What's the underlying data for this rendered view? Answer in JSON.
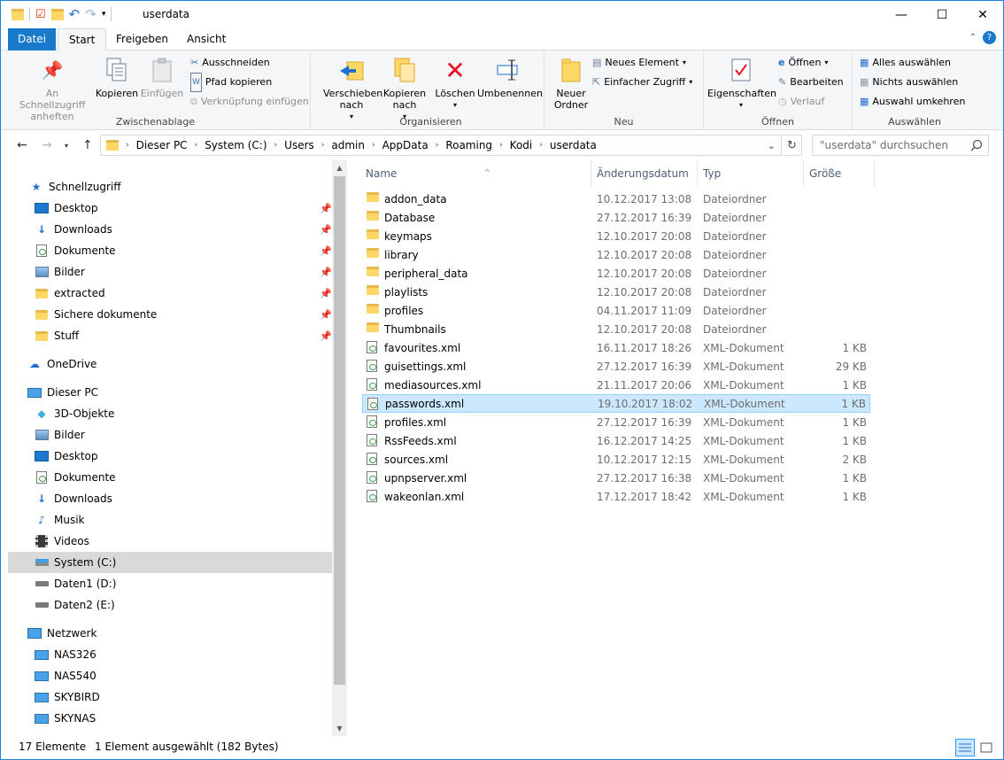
{
  "window": {
    "title": "userdata",
    "minimize": "—",
    "maximize": "☐",
    "close": "✕"
  },
  "tabs": [
    {
      "label": "Datei"
    },
    {
      "label": "Start"
    },
    {
      "label": "Freigeben"
    },
    {
      "label": "Ansicht"
    }
  ],
  "ribbon": {
    "clipboard": {
      "group_label": "Zwischenablage",
      "pin_quick_access": "An Schnellzugriff anheften",
      "copy": "Kopieren",
      "paste": "Einfügen",
      "cut": "Ausschneiden",
      "copy_path": "Pfad kopieren",
      "paste_shortcut": "Verknüpfung einfügen"
    },
    "organize": {
      "group_label": "Organisieren",
      "move_to": "Verschieben nach",
      "copy_to": "Kopieren nach",
      "delete": "Löschen",
      "rename": "Umbenennen"
    },
    "new": {
      "group_label": "Neu",
      "new_folder": "Neuer Ordner",
      "new_item": "Neues Element",
      "easy_access": "Einfacher Zugriff"
    },
    "open": {
      "group_label": "Öffnen",
      "properties": "Eigenschaften",
      "open": "Öffnen",
      "edit": "Bearbeiten",
      "history": "Verlauf"
    },
    "select": {
      "group_label": "Auswählen",
      "select_all": "Alles auswählen",
      "select_none": "Nichts auswählen",
      "invert": "Auswahl umkehren"
    }
  },
  "address": {
    "crumbs": [
      "Dieser PC",
      "System (C:)",
      "Users",
      "admin",
      "AppData",
      "Roaming",
      "Kodi",
      "userdata"
    ],
    "search_placeholder": "\"userdata\" durchsuchen"
  },
  "nav": {
    "quick_access": "Schnellzugriff",
    "quick_items": [
      "Desktop",
      "Downloads",
      "Dokumente",
      "Bilder",
      "extracted",
      "Sichere dokumente",
      "Stuff"
    ],
    "onedrive": "OneDrive",
    "this_pc": "Dieser PC",
    "pc_items": [
      "3D-Objekte",
      "Bilder",
      "Desktop",
      "Dokumente",
      "Downloads",
      "Musik",
      "Videos",
      "System (C:)",
      "Daten1 (D:)",
      "Daten2 (E:)"
    ],
    "network": "Netzwerk",
    "network_items": [
      "NAS326",
      "NAS540",
      "SKYBIRD",
      "SKYNAS"
    ]
  },
  "columns": {
    "name": "Name",
    "date": "Änderungsdatum",
    "type": "Typ",
    "size": "Größe"
  },
  "files": [
    {
      "name": "addon_data",
      "date": "10.12.2017 13:08",
      "type": "Dateiordner",
      "size": "",
      "kind": "folder"
    },
    {
      "name": "Database",
      "date": "27.12.2017 16:39",
      "type": "Dateiordner",
      "size": "",
      "kind": "folder"
    },
    {
      "name": "keymaps",
      "date": "12.10.2017 20:08",
      "type": "Dateiordner",
      "size": "",
      "kind": "folder"
    },
    {
      "name": "library",
      "date": "12.10.2017 20:08",
      "type": "Dateiordner",
      "size": "",
      "kind": "folder"
    },
    {
      "name": "peripheral_data",
      "date": "12.10.2017 20:08",
      "type": "Dateiordner",
      "size": "",
      "kind": "folder"
    },
    {
      "name": "playlists",
      "date": "12.10.2017 20:08",
      "type": "Dateiordner",
      "size": "",
      "kind": "folder"
    },
    {
      "name": "profiles",
      "date": "04.11.2017 11:09",
      "type": "Dateiordner",
      "size": "",
      "kind": "folder"
    },
    {
      "name": "Thumbnails",
      "date": "12.10.2017 20:08",
      "type": "Dateiordner",
      "size": "",
      "kind": "folder"
    },
    {
      "name": "favourites.xml",
      "date": "16.11.2017 18:26",
      "type": "XML-Dokument",
      "size": "1 KB",
      "kind": "xml"
    },
    {
      "name": "guisettings.xml",
      "date": "27.12.2017 16:39",
      "type": "XML-Dokument",
      "size": "29 KB",
      "kind": "xml"
    },
    {
      "name": "mediasources.xml",
      "date": "21.11.2017 20:06",
      "type": "XML-Dokument",
      "size": "1 KB",
      "kind": "xml"
    },
    {
      "name": "passwords.xml",
      "date": "19.10.2017 18:02",
      "type": "XML-Dokument",
      "size": "1 KB",
      "kind": "xml",
      "selected": true
    },
    {
      "name": "profiles.xml",
      "date": "27.12.2017 16:39",
      "type": "XML-Dokument",
      "size": "1 KB",
      "kind": "xml"
    },
    {
      "name": "RssFeeds.xml",
      "date": "16.12.2017 14:25",
      "type": "XML-Dokument",
      "size": "1 KB",
      "kind": "xml"
    },
    {
      "name": "sources.xml",
      "date": "10.12.2017 12:15",
      "type": "XML-Dokument",
      "size": "2 KB",
      "kind": "xml"
    },
    {
      "name": "upnpserver.xml",
      "date": "27.12.2017 16:38",
      "type": "XML-Dokument",
      "size": "1 KB",
      "kind": "xml"
    },
    {
      "name": "wakeonlan.xml",
      "date": "17.12.2017 18:42",
      "type": "XML-Dokument",
      "size": "1 KB",
      "kind": "xml"
    }
  ],
  "status": {
    "count": "17 Elemente",
    "selection": "1 Element ausgewählt (182 Bytes)"
  },
  "colors": {
    "accent": "#1979ca",
    "selection": "#cce8ff",
    "folder": "#ffd767"
  }
}
